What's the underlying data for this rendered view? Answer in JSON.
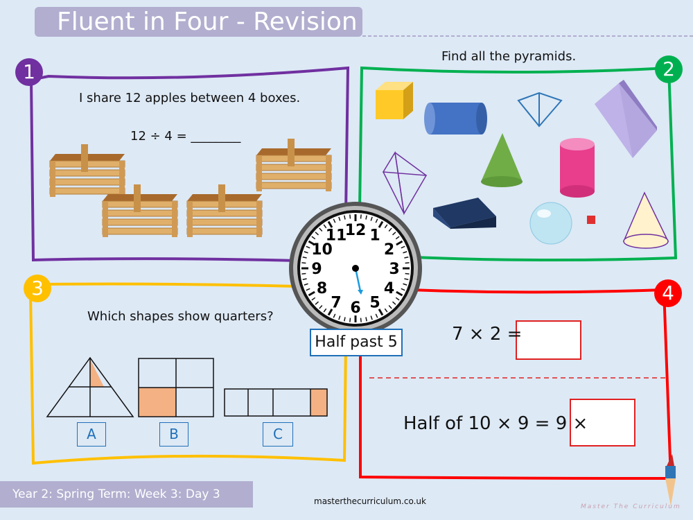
{
  "header": {
    "title": "Fluent in Four - Revision"
  },
  "colors": {
    "q1": "#7030a0",
    "q2": "#00b050",
    "q3": "#ffc000",
    "q4": "#ff0000",
    "accent": "#1f6fb8",
    "banner": "#b1aecf"
  },
  "q1": {
    "number": "1",
    "prompt": "I share 12 apples between 4 boxes.",
    "equation": "12 ÷ 4 = ________",
    "images": [
      "crate",
      "crate",
      "crate",
      "crate"
    ]
  },
  "q2": {
    "number": "2",
    "prompt": "Find all the pyramids.",
    "shapes": [
      "cube",
      "cylinder",
      "square-pyramid",
      "cuboid",
      "cone",
      "triangular-pyramid",
      "cylinder",
      "cuboid",
      "sphere",
      "cube",
      "cone"
    ]
  },
  "q3": {
    "number": "3",
    "prompt": "Which shapes show quarters?",
    "options": [
      "A",
      "B",
      "C"
    ]
  },
  "q4": {
    "number": "4",
    "q1": "7 × 2 =",
    "q2": "Half of 10 × 9 = 9 ×"
  },
  "clock": {
    "label": "Half past 5",
    "numbers": [
      "12",
      "1",
      "2",
      "3",
      "4",
      "5",
      "6",
      "7",
      "8",
      "9",
      "10",
      "11"
    ]
  },
  "footer": {
    "lesson": "Year 2: Spring Term: Week 3: Day 3",
    "website": "masterthecurriculum.co.uk",
    "brand": "Master The Curriculum"
  }
}
